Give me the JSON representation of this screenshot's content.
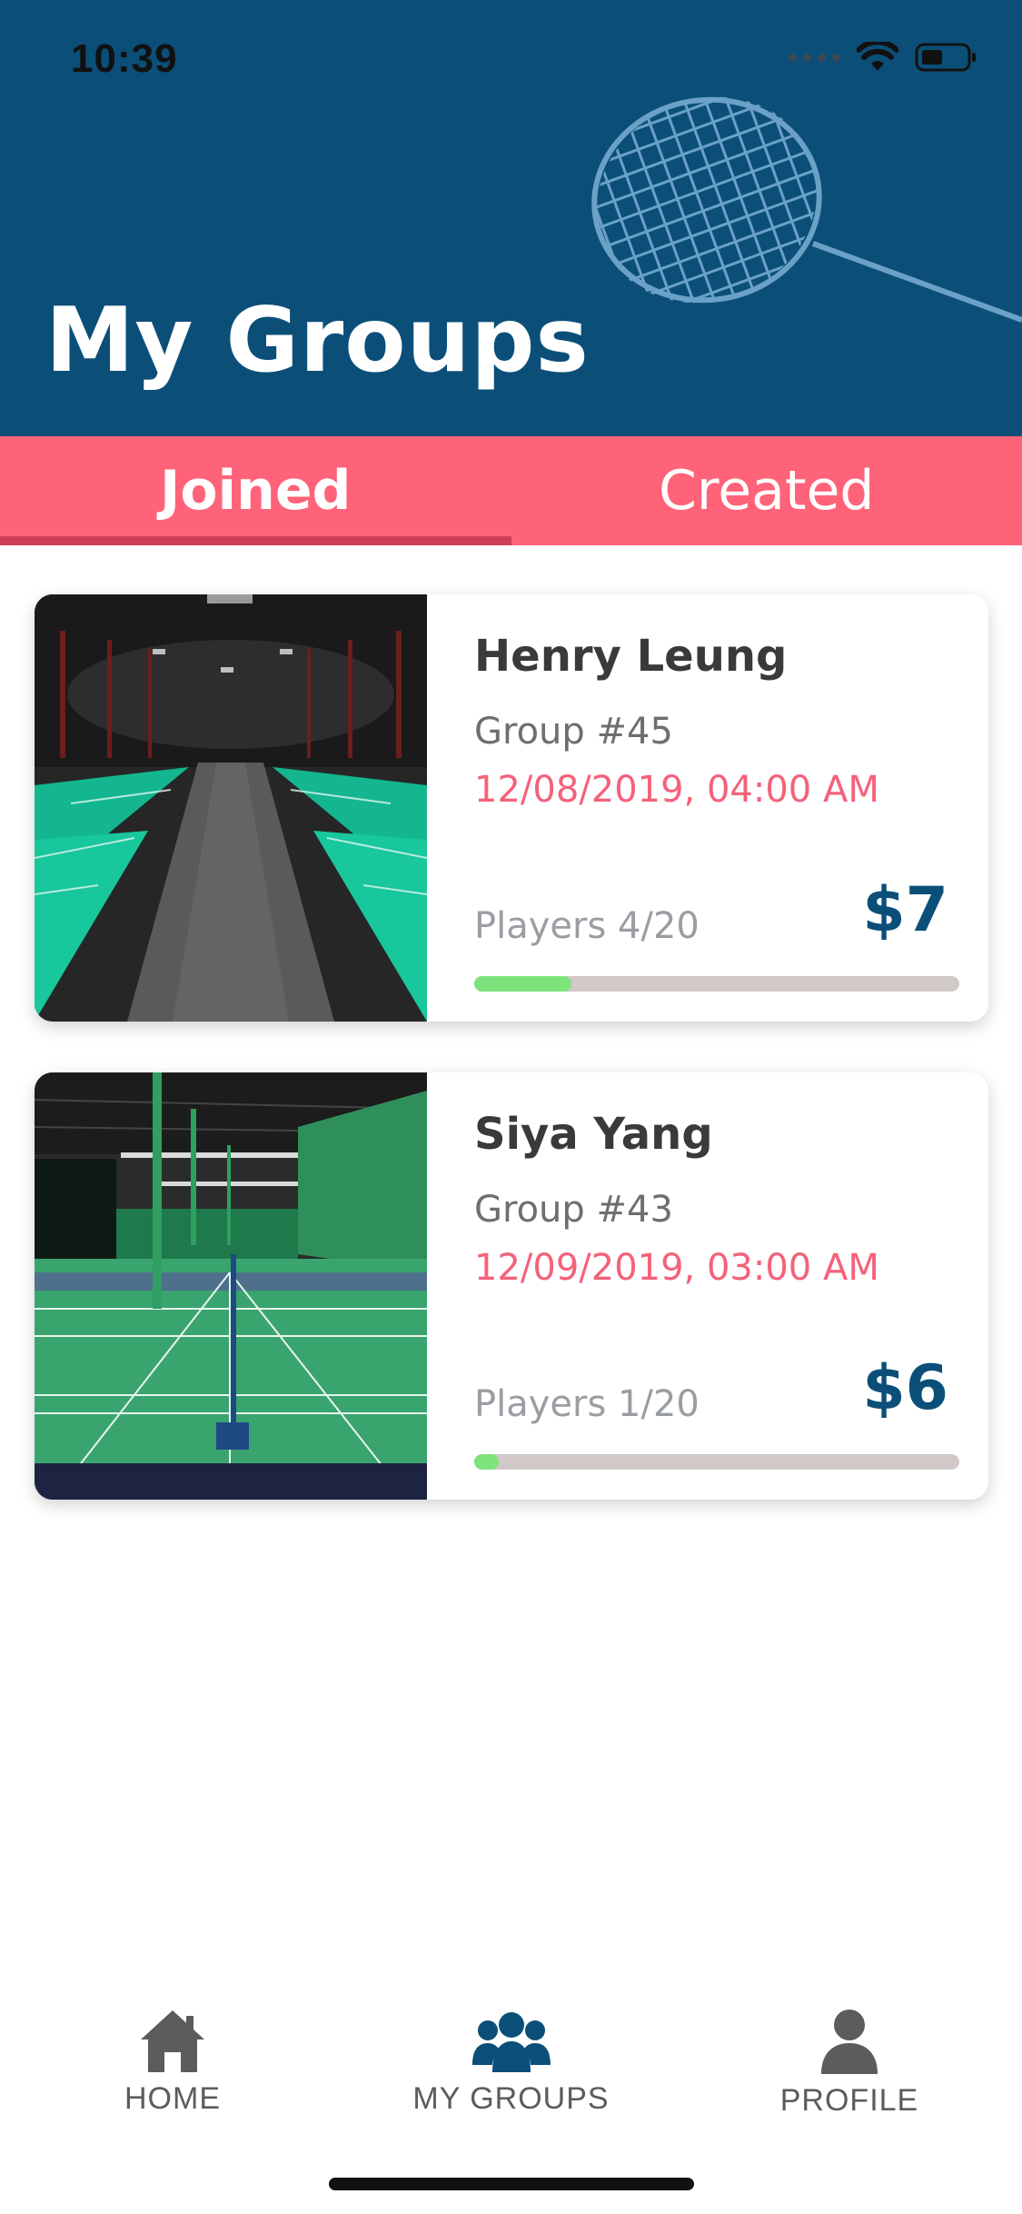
{
  "status_bar": {
    "time": "10:39"
  },
  "header": {
    "title": "My Groups"
  },
  "tabs": [
    {
      "label": "Joined",
      "active": true
    },
    {
      "label": "Created",
      "active": false
    }
  ],
  "groups": [
    {
      "organizer": "Henry Leung",
      "group_no": "Group #45",
      "datetime": "12/08/2019, 04:00 AM",
      "players_label": "Players 4/20",
      "players_joined": 4,
      "players_max": 20,
      "price": "$7"
    },
    {
      "organizer": "Siya Yang",
      "group_no": "Group #43",
      "datetime": "12/09/2019, 03:00 AM",
      "players_label": "Players 1/20",
      "players_joined": 1,
      "players_max": 20,
      "price": "$6"
    }
  ],
  "bottom_nav": [
    {
      "label": "HOME",
      "icon": "home-icon",
      "active": false
    },
    {
      "label": "MY GROUPS",
      "icon": "groups-icon",
      "active": true
    },
    {
      "label": "PROFILE",
      "icon": "user-icon",
      "active": false
    }
  ],
  "colors": {
    "header_bg": "#0b4f79",
    "tab_bg": "#fe6379",
    "tab_indicator": "#cf3d54",
    "datetime": "#f4627a",
    "price": "#0b4f79",
    "progress_fill": "#7de37c",
    "progress_track": "#d1c8c8",
    "nav_active": "#0b4f79",
    "nav_inactive": "#5c5c5c"
  }
}
